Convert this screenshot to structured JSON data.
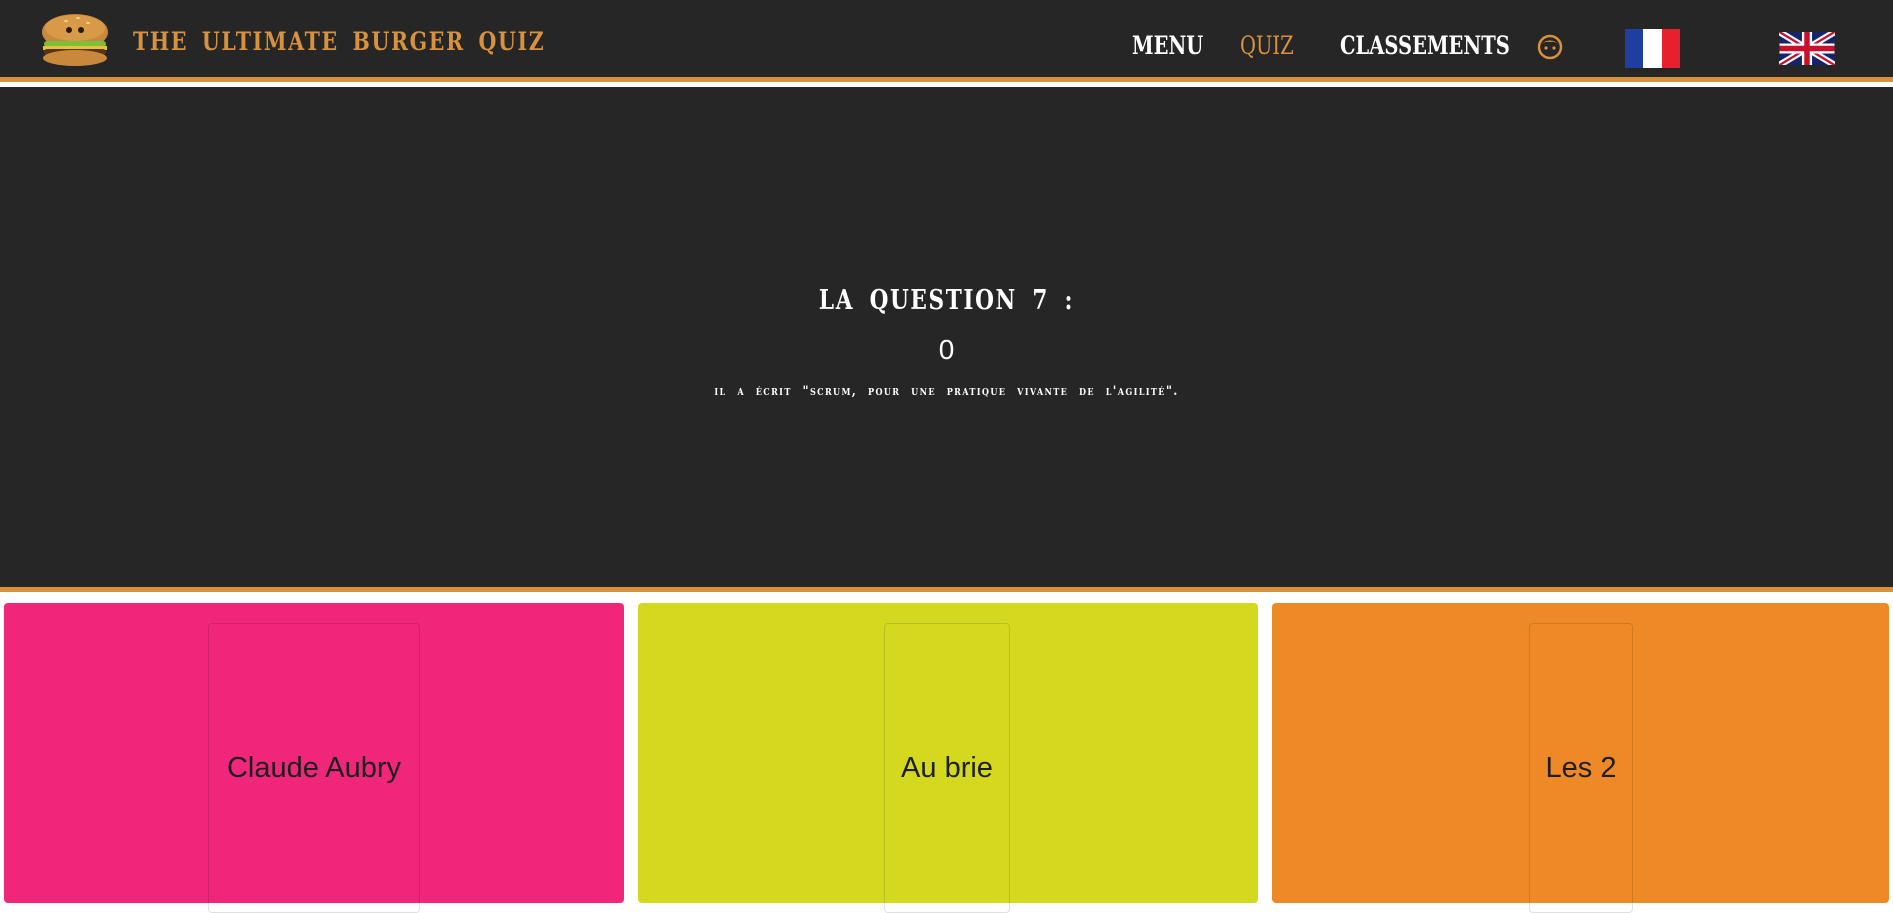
{
  "header": {
    "brand": "THE ULTIMATE BURGER QUIZ",
    "nav": {
      "menu": "MENU",
      "quiz": "QUIZ",
      "classements": "CLASSEMENTS"
    },
    "icons": {
      "logo": "burger-logo",
      "user": "user-face-icon",
      "lang_fr": "france-flag-icon",
      "lang_en": "uk-flag-icon"
    }
  },
  "question": {
    "title": "LA QUESTION 7 :",
    "timer": "0",
    "text": "Il a écrit \"Scrum, pour une pratique vivante de l'agilité\"."
  },
  "answers": [
    {
      "label": "Claude Aubry",
      "color": "#ef267a"
    },
    {
      "label": "Au brie",
      "color": "#d4d920"
    },
    {
      "label": "Les 2",
      "color": "#ed8a27"
    }
  ],
  "colors": {
    "background": "#262626",
    "accent": "#d8913d"
  }
}
